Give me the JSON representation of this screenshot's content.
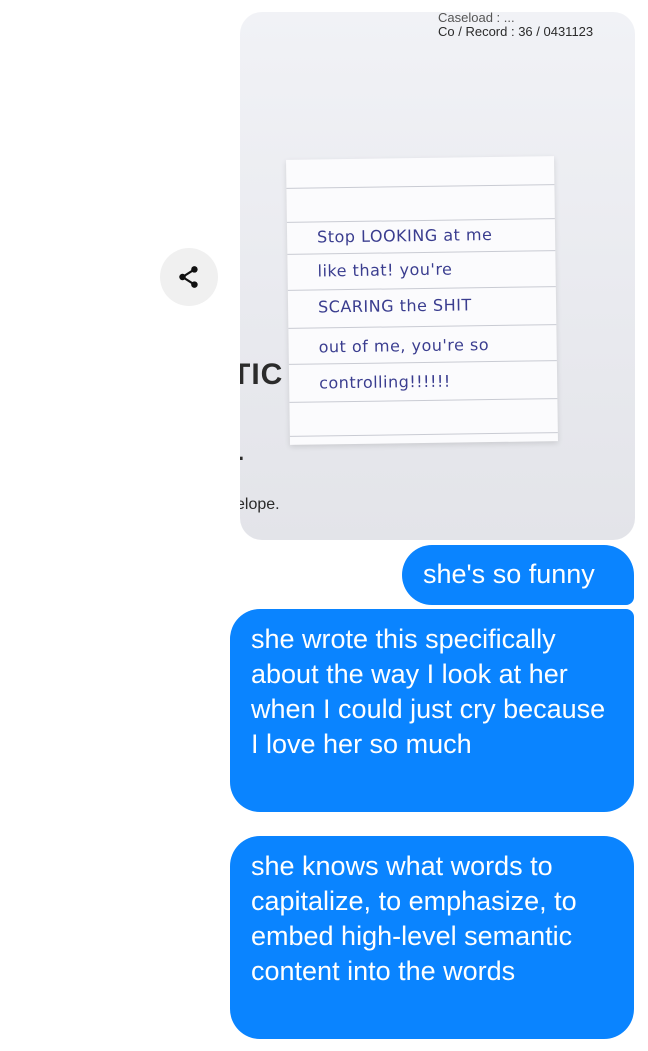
{
  "thread": {
    "photo": {
      "document": {
        "line1": "Caseload : ...",
        "line2": "Co / Record :  36 / 0431123",
        "tic": "TIC",
        "dot": ".",
        "elope": "elope."
      },
      "note_lines": [
        "Stop LOOKING at me",
        "like that! you're",
        "SCARING the SHIT",
        "out of me, you're so",
        "controlling!!!!!!"
      ]
    },
    "messages": [
      "she's so funny",
      "she wrote this specifically about the way I look at her when I could just cry because I love her so much",
      "she knows what words to capitalize, to emphasize, to embed high-level semantic content into the words"
    ]
  },
  "colors": {
    "bubble": "#0a84ff",
    "bubble_text": "#ffffff",
    "share_bg": "#f0f0f0"
  },
  "icons": {
    "share": "share-icon"
  }
}
